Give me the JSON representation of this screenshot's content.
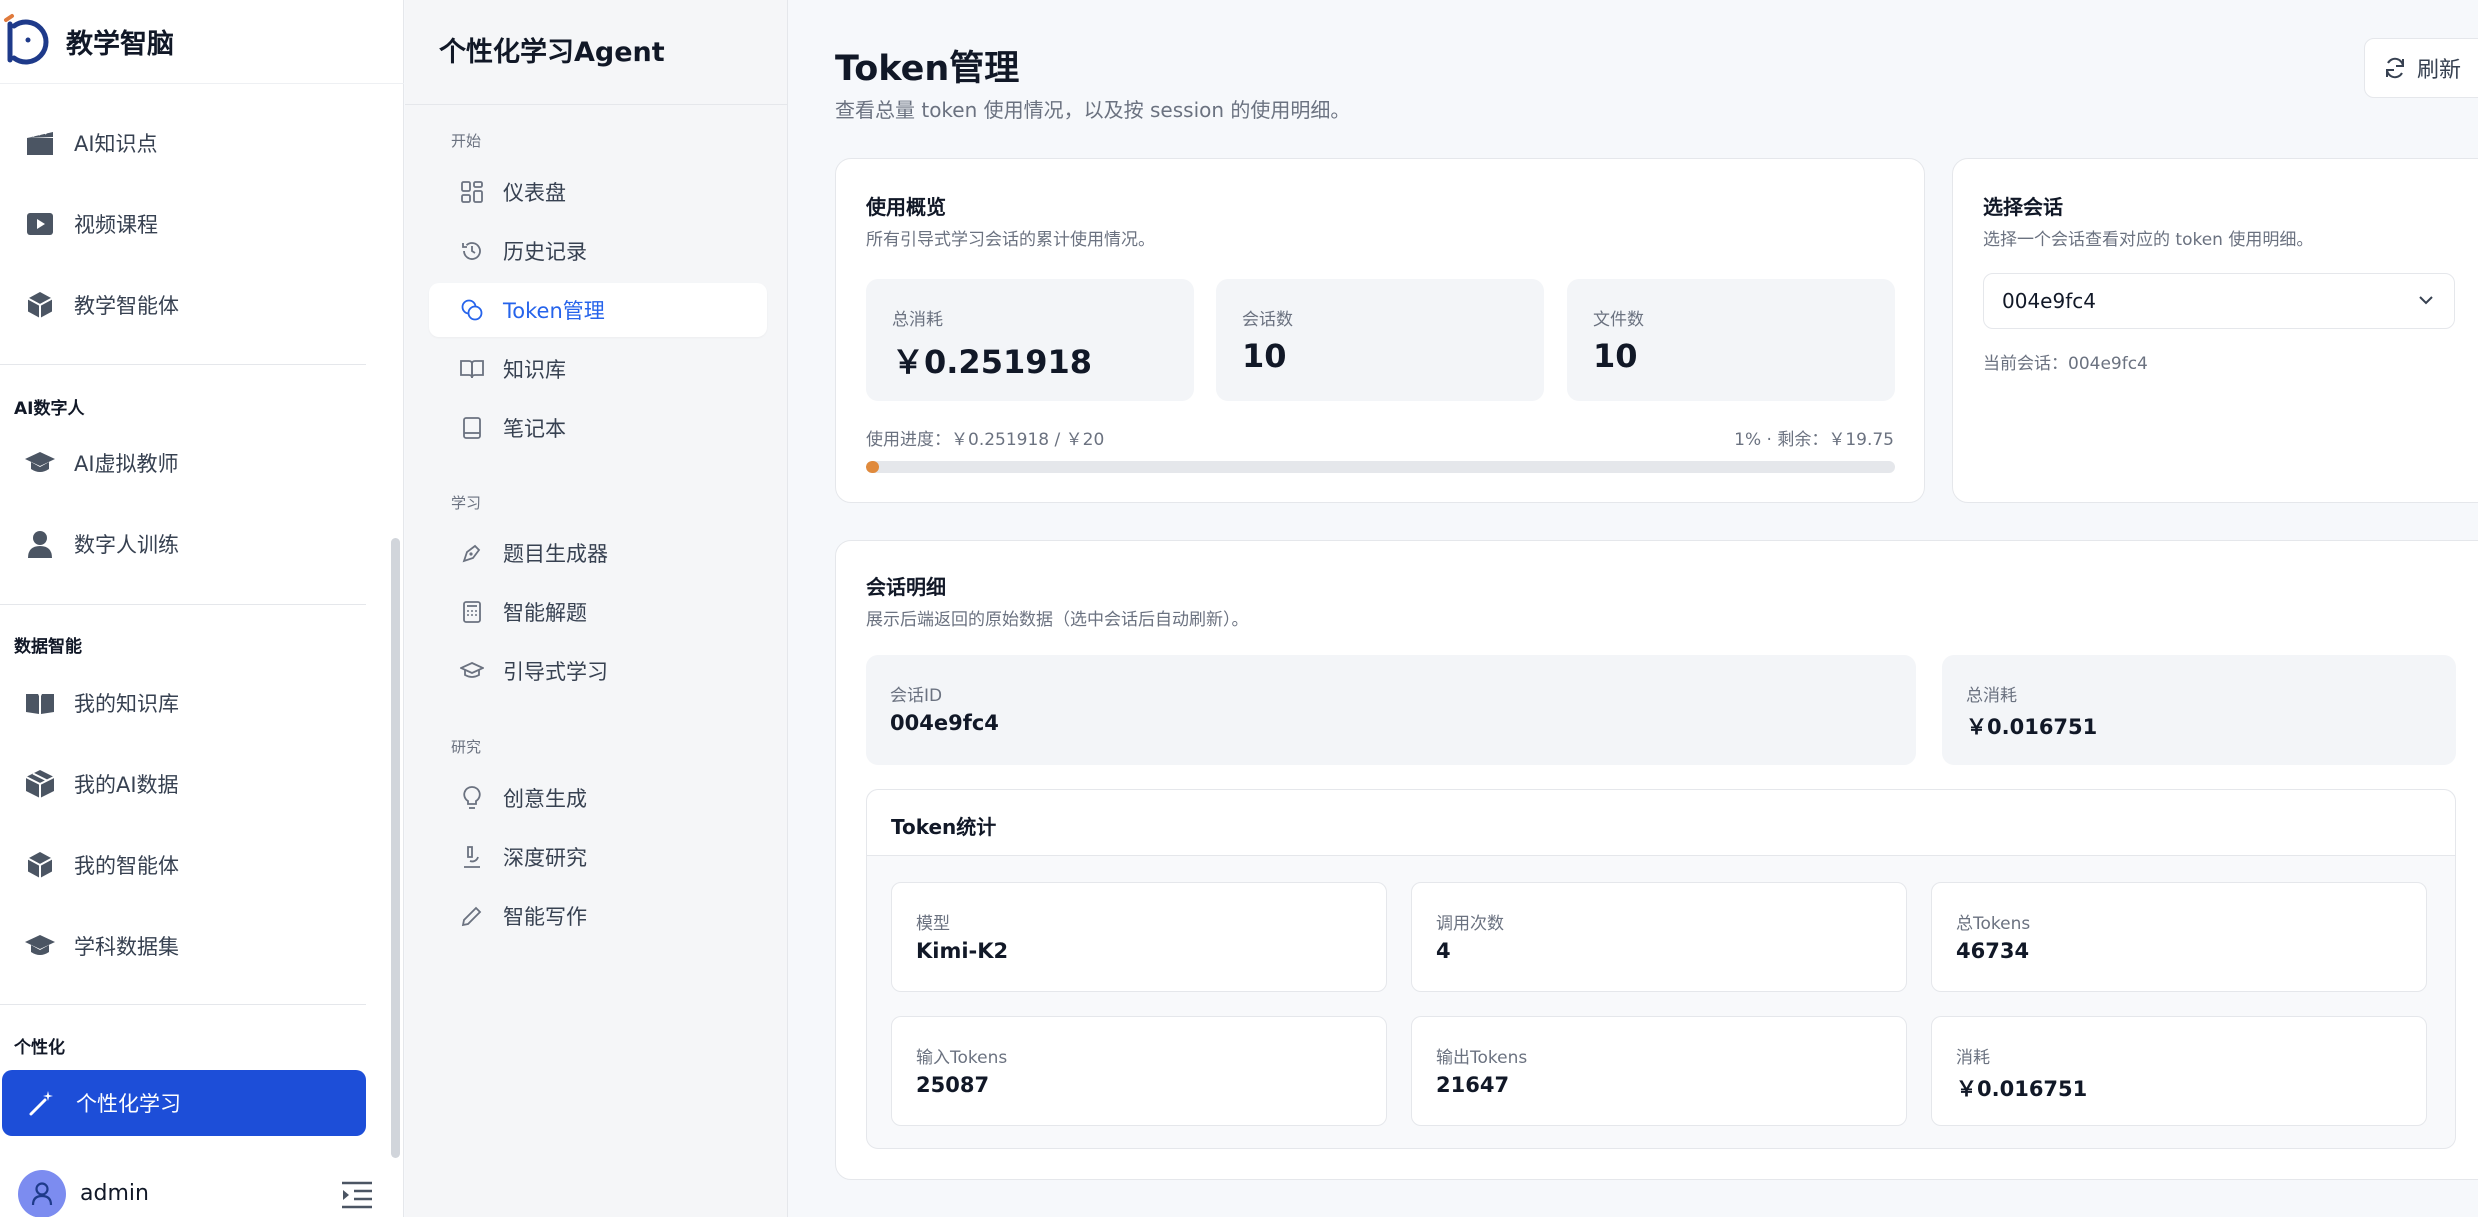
{
  "brand": {
    "name": "教学智脑"
  },
  "sidebar": {
    "items_top": [
      {
        "label": "AI知识点",
        "icon": "clapperboard-icon"
      },
      {
        "label": "视频课程",
        "icon": "video-play-icon"
      },
      {
        "label": "教学智能体",
        "icon": "cube-icon"
      }
    ],
    "section_digital": "AI数字人",
    "items_digital": [
      {
        "label": "AI虚拟教师",
        "icon": "graduation-cap-icon"
      },
      {
        "label": "数字人训练",
        "icon": "person-icon"
      }
    ],
    "section_data": "数据智能",
    "items_data": [
      {
        "label": "我的知识库",
        "icon": "open-book-icon"
      },
      {
        "label": "我的AI数据",
        "icon": "boxes-icon"
      },
      {
        "label": "我的智能体",
        "icon": "cube-icon"
      },
      {
        "label": "学科数据集",
        "icon": "graduation-cap-icon"
      }
    ],
    "section_personal": "个性化",
    "active_item": {
      "label": "个性化学习",
      "icon": "magic-wand-icon"
    },
    "user": {
      "name": "admin"
    }
  },
  "subnav": {
    "title": "个性化学习Agent",
    "sections": [
      {
        "title": "开始",
        "items": [
          "仪表盘",
          "历史记录",
          "Token管理",
          "知识库",
          "笔记本"
        ]
      },
      {
        "title": "学习",
        "items": [
          "题目生成器",
          "智能解题",
          "引导式学习"
        ]
      },
      {
        "title": "研究",
        "items": [
          "创意生成",
          "深度研究",
          "智能写作"
        ]
      }
    ],
    "active": "Token管理"
  },
  "main": {
    "title": "Token管理",
    "desc": "查看总量 token 使用情况，以及按 session 的使用明细。",
    "refresh": "刷新",
    "overview": {
      "title": "使用概览",
      "subtitle": "所有引导式学习会话的累计使用情况。",
      "stats": [
        {
          "label": "总消耗",
          "value": "￥0.251918"
        },
        {
          "label": "会话数",
          "value": "10"
        },
        {
          "label": "文件数",
          "value": "10"
        }
      ],
      "progress_left": "使用进度：￥0.251918 / ￥20",
      "progress_right": "1% · 剩余：￥19.75",
      "progress_fraction": 0.0126
    },
    "session_select": {
      "title": "选择会话",
      "subtitle": "选择一个会话查看对应的 token 使用明细。",
      "selected": "004e9fc4",
      "current": "当前会话：004e9fc4"
    },
    "detail": {
      "title": "会话明细",
      "subtitle": "展示后端返回的原始数据（选中会话后自动刷新）。",
      "session_id_label": "会话ID",
      "session_id": "004e9fc4",
      "total_cost_label": "总消耗",
      "total_cost": "￥0.016751",
      "token_stats": {
        "title": "Token统计",
        "cells": [
          {
            "label": "模型",
            "value": "Kimi-K2"
          },
          {
            "label": "调用次数",
            "value": "4"
          },
          {
            "label": "总Tokens",
            "value": "46734"
          },
          {
            "label": "输入Tokens",
            "value": "25087"
          },
          {
            "label": "输出Tokens",
            "value": "21647"
          },
          {
            "label": "消耗",
            "value": "￥0.016751"
          }
        ]
      }
    }
  },
  "colors": {
    "primary": "#1d4ed8",
    "accent": "#2563eb",
    "progress": "#e08a3c"
  }
}
